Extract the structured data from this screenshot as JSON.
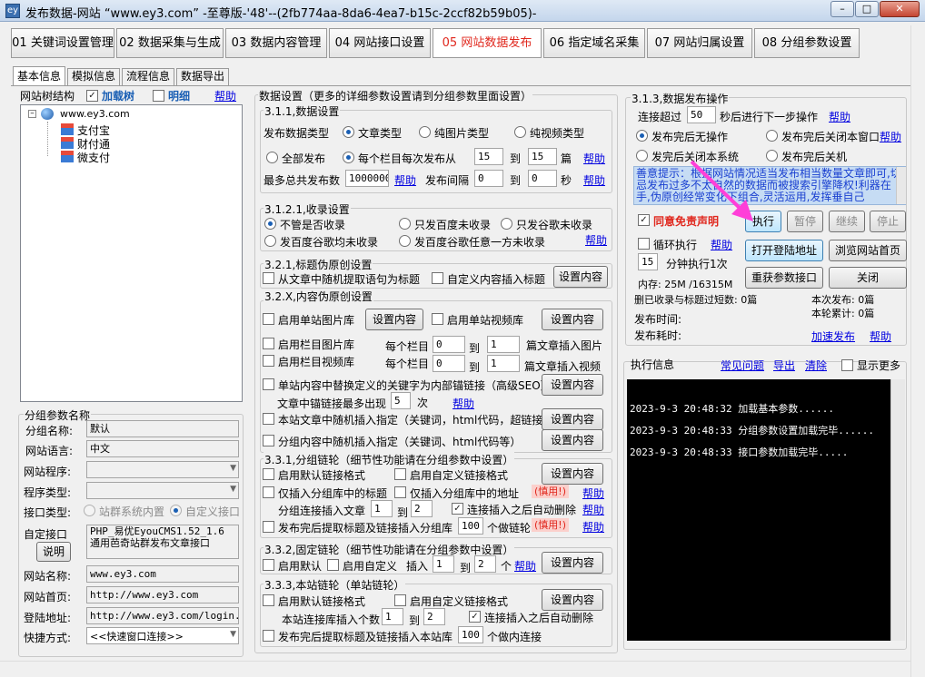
{
  "window": {
    "title": "发布数据-网站 “www.ey3.com” -至尊版-'48'--(2fb774aa-8da6-4ea7-b15c-2ccf82b59b05)-",
    "icon_label": "ey",
    "min_symbol": "–",
    "max_symbol": "□",
    "close_symbol": "✕"
  },
  "main_tabs": [
    {
      "label": "01 关键词设置管理"
    },
    {
      "label": "02 数据采集与生成"
    },
    {
      "label": "03 数据内容管理"
    },
    {
      "label": "04 网站接口设置"
    },
    {
      "label": "05 网站数据发布"
    },
    {
      "label": "06 指定域名采集"
    },
    {
      "label": "07 网站归属设置"
    },
    {
      "label": "08 分组参数设置"
    }
  ],
  "sub_tabs": [
    {
      "label": "基本信息"
    },
    {
      "label": "模拟信息"
    },
    {
      "label": "流程信息"
    },
    {
      "label": "数据导出"
    }
  ],
  "tree_panel": {
    "title": "网站树结构",
    "load_tree_label": "加载树",
    "load_tree_checked": true,
    "detail_label": "明细",
    "detail_checked": false,
    "help": "帮助",
    "root": "www.ey3.com",
    "root_toggle": "–",
    "children": [
      "支付宝",
      "财付通",
      "微支付"
    ]
  },
  "group_params": {
    "title": "分组参数名称",
    "labels": {
      "group_name": "分组名称:",
      "site_lang": "网站语言:",
      "site_program": "网站程序:",
      "program_type": "程序类型:",
      "iface_type": "接口类型:",
      "custom_iface": "自定接口",
      "site_name": "网站名称:",
      "homepage": "网站首页:",
      "login": "登陆地址:",
      "shortcut": "快捷方式:"
    },
    "values": {
      "group_name": "默认",
      "site_lang": "中文",
      "site_name": "www.ey3.com",
      "homepage": "http://www.ey3.com",
      "login": "http://www.ey3.com/login.ph",
      "shortcut": "<<快速窗口连接>>"
    },
    "iface_options": [
      "站群系统内置",
      "自定义接口"
    ],
    "iface_selected": 1,
    "custom_iface_line1": "PHP_易优EyouCMS1.52_1.6",
    "custom_iface_line2": "通用芭奇站群发布文章接口",
    "explain_button": "说明"
  },
  "data_settings": {
    "title": "数据设置（更多的详细参数设置请到分组参数里面设置）",
    "s311": {
      "title": "3.1.1,数据设置",
      "publish_type_label": "发布数据类型",
      "types": [
        "文章类型",
        "纯图片类型",
        "纯视频类型"
      ],
      "type_selected": 0,
      "all_publish": "全部发布",
      "per_column": "每个栏目每次发布从",
      "per_from": "15",
      "to": "到",
      "per_to": "15",
      "unit": "篇",
      "max_total_label": "最多总共发布数",
      "max_total": "1000000",
      "interval_label": "发布间隔",
      "interval_from": "0",
      "interval_to": "0",
      "sec": "秒",
      "help": "帮助",
      "mode_selected": 1
    },
    "s3121": {
      "title": "3.1.2.1,收录设置",
      "options": [
        "不管是否收录",
        "只发百度未收录",
        "只发谷歌未收录",
        "发百度谷歌均未收录",
        "发百度谷歌任意一方未收录"
      ],
      "selected": 0,
      "help": "帮助"
    },
    "s321": {
      "title": "3.2.1,标题伪原创设置",
      "opt1": "从文章中随机提取语句为标题",
      "opt2": "自定义内容插入标题",
      "setting": "设置内容"
    },
    "s32x": {
      "title": "3.2.X,内容伪原创设置",
      "single_img": "启用单站图片库",
      "single_video": "启用单站视频库",
      "col_img": "启用栏目图片库",
      "col_video": "启用栏目视频库",
      "per_column": "每个栏目",
      "img_from": "0",
      "img_to": "1",
      "video_from": "0",
      "video_to": "1",
      "to": "到",
      "img_suffix": "篇文章插入图片",
      "video_suffix": "篇文章插入视频",
      "replace_kw": "单站内容中替换定义的关键字为内部锚链接（高级SEO）",
      "anchor_max": "文章中锚链接最多出现",
      "anchor_count": "5",
      "times": "次",
      "help": "帮助",
      "rand_insert": "本站文章中随机插入指定（关键词，html代码，超链接等）",
      "group_insert": "分组内容中随机插入指定（关键词、html代码等）",
      "setting": "设置内容"
    },
    "s331": {
      "title": "3.3.1,分组链轮（细节性功能请在分组参数中设置）",
      "default_fmt": "启用默认链接格式",
      "custom_fmt": "启用自定义链接格式",
      "only_title": "仅插入分组库中的标题",
      "only_addr": "仅插入分组库中的地址",
      "caution": "(慎用!)",
      "help": "帮助",
      "group_insert": "分组连接插入文章",
      "from": "1",
      "to_label": "到",
      "to": "2",
      "auto_delete": "连接插入之后自动删除",
      "auto_delete_checked": true,
      "extract": "发布完后提取标题及链接插入分组库",
      "count": "100",
      "within": "个做链轮",
      "setting": "设置内容"
    },
    "s332": {
      "title": "3.3.2,固定链轮（细节性功能请在分组参数中设置）",
      "default": "启用默认",
      "custom": "启用自定义",
      "insert": "插入",
      "from": "1",
      "to_label": "到",
      "to": "2",
      "unit": "个",
      "help": "帮助",
      "setting": "设置内容"
    },
    "s333": {
      "title": "3.3.3,本站链轮（单站链轮）",
      "default_fmt": "启用默认链接格式",
      "custom_fmt": "启用自定义链接格式",
      "per_article": "本站连接库插入个数",
      "from": "1",
      "to_label": "到",
      "to": "2",
      "auto_delete": "连接插入之后自动删除",
      "auto_delete_checked": true,
      "extract": "发布完后提取标题及链接插入本站库",
      "count": "100",
      "within": "个做内连接",
      "setting": "设置内容"
    }
  },
  "publish_ops": {
    "title": "3.1.3,数据发布操作",
    "timeout_pre": "连接超过",
    "timeout_value": "50",
    "timeout_post": "秒后进行下一步操作",
    "help": "帮助",
    "after_options": [
      "发布完后无操作",
      "发布完后关闭本窗口",
      "发完后关闭本系统",
      "发布完后关机"
    ],
    "after_selected": 0,
    "tip": "善意提示：根据网站情况适当发布相当数量文章即可,切忌发布过多不太自然的数据而被搜索引擎降权!利器在手,伪原创经常变化下组合,灵活运用,发挥垂自己",
    "agree_label": "同意免责声明",
    "agree_checked": true,
    "execute": "执行",
    "pause": "暂停",
    "resume": "继续",
    "stop": "停止",
    "loop": "循环执行",
    "loop_help": "帮助",
    "open_login": "打开登陆地址",
    "browse_home": "浏览网站首页",
    "minutes_value": "15",
    "minutes_label": "分钟执行1次",
    "reload": "重获参数接口",
    "close": "关闭",
    "memory": "内存: 25M /16315M",
    "deleted_label": "删已收录与标题过短数: 0篇",
    "this_publish": "本次发布: 0篇",
    "this_total": "本轮累计: 0篇",
    "publish_time": "发布时间:",
    "elapsed": "发布耗时:",
    "speed_publish": "加速发布",
    "help2": "帮助"
  },
  "exec_info": {
    "title": "执行信息",
    "faq": "常见问题",
    "export": "导出",
    "clear": "清除",
    "show_more": "显示更多",
    "logs": [
      "2023-9-3 20:48:32  加载基本参数......",
      "2023-9-3 20:48:33  分组参数设置加载完毕......",
      "2023-9-3 20:48:33  接口参数加载完毕....."
    ]
  },
  "colors": {
    "active_tab_text": "#e0281e",
    "link": "#0000e0",
    "annotation_arrow": "#ff3fd8",
    "log_background": "#000000"
  }
}
